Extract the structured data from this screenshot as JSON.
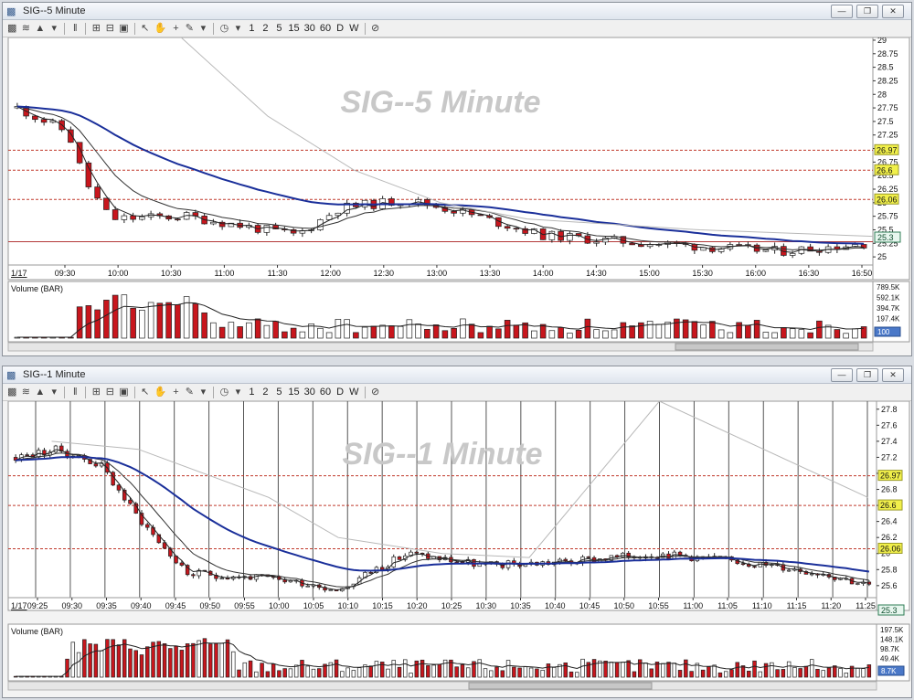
{
  "windows": [
    {
      "title": "SIG--5 Minute",
      "watermark": "SIG--5 Minute",
      "price_levels": [
        "26.97",
        "26.6",
        "26.06"
      ],
      "last_price_tag": "25.3",
      "date_label": "1/17",
      "volume_label": "Volume (BAR)",
      "volume_tag": "100",
      "chart_data": {
        "type": "candlestick",
        "x_labels": [
          "09:30",
          "10:00",
          "10:30",
          "11:00",
          "11:30",
          "12:00",
          "12:30",
          "13:00",
          "13:30",
          "14:00",
          "14:30",
          "15:00",
          "15:30",
          "16:00",
          "16:30",
          "16:50"
        ],
        "ylim": [
          24.85,
          29.05
        ],
        "y_ticks": [
          29,
          28.75,
          28.5,
          28.25,
          28,
          27.75,
          27.5,
          27.25,
          27,
          26.75,
          26.5,
          26.25,
          26,
          25.75,
          25.5,
          25.25,
          25
        ],
        "horizontal_lines": [
          26.97,
          26.6,
          26.06,
          25.28
        ],
        "volume_ticks": [
          "789.5K",
          "592.1K",
          "394.7K",
          "197.4K"
        ]
      }
    },
    {
      "title": "SIG--1 Minute",
      "watermark": "SIG--1 Minute",
      "price_levels": [
        "26.97",
        "26.6",
        "26.06"
      ],
      "last_price_tag": "25.3",
      "date_label": "1/17",
      "volume_label": "Volume (BAR)",
      "volume_tag": "8.7K",
      "chart_data": {
        "type": "candlestick",
        "x_labels": [
          "09:25",
          "09:30",
          "09:35",
          "09:40",
          "09:45",
          "09:50",
          "09:55",
          "10:00",
          "10:05",
          "10:10",
          "10:15",
          "10:20",
          "10:25",
          "10:30",
          "10:35",
          "10:40",
          "10:45",
          "10:50",
          "10:55",
          "11:00",
          "11:05",
          "11:10",
          "11:15",
          "11:20",
          "11:25"
        ],
        "ylim": [
          25.45,
          27.9
        ],
        "y_ticks": [
          27.8,
          27.6,
          27.4,
          27.2,
          27,
          26.8,
          26.6,
          26.4,
          26.2,
          26,
          25.8,
          25.6
        ],
        "horizontal_lines": [
          26.97,
          26.6,
          26.06
        ],
        "volume_ticks": [
          "197.5K",
          "148.1K",
          "98.7K",
          "49.4K"
        ]
      }
    }
  ],
  "toolbar": {
    "periods": [
      "1",
      "2",
      "5",
      "15",
      "30",
      "60",
      "D",
      "W"
    ]
  },
  "colors": {
    "up": "#ffffff",
    "down": "#c8161d",
    "ma_slow": "#1a2f9a",
    "dashed_level": "#c0392b",
    "price_tag": "#f1f04a"
  }
}
